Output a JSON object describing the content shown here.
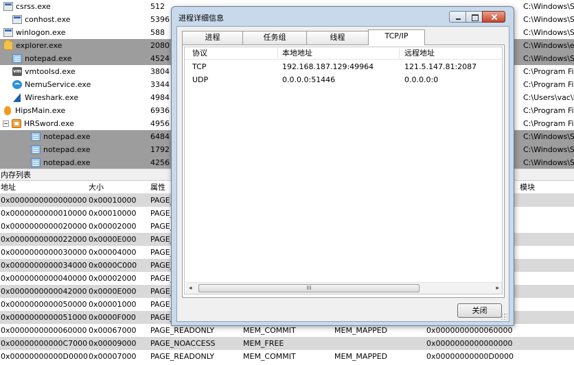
{
  "processes": [
    {
      "name": "csrss.exe",
      "pid": "512",
      "path": "C:\\Windows\\S",
      "icon": "window-icon",
      "indent": 1,
      "highlight": false
    },
    {
      "name": "conhost.exe",
      "pid": "5396",
      "path": "C:\\Windows\\S",
      "icon": "window-icon",
      "indent": 2,
      "highlight": false
    },
    {
      "name": "winlogon.exe",
      "pid": "588",
      "path": "C:\\Windows\\S",
      "icon": "window-icon",
      "indent": 1,
      "highlight": false
    },
    {
      "name": "explorer.exe",
      "pid": "2080",
      "path": "C:\\Windows\\e",
      "icon": "folder-icon",
      "indent": 1,
      "highlight": true
    },
    {
      "name": "notepad.exe",
      "pid": "4524",
      "path": "C:\\Windows\\S",
      "icon": "notepad-icon",
      "indent": 2,
      "highlight": true
    },
    {
      "name": "vmtoolsd.exe",
      "pid": "3804",
      "path": "C:\\Program Fil",
      "icon": "vmware-icon",
      "indent": 2,
      "highlight": false
    },
    {
      "name": "NemuService.exe",
      "pid": "3344",
      "path": "C:\\Program Fil",
      "icon": "nemu-icon",
      "indent": 2,
      "highlight": false
    },
    {
      "name": "Wireshark.exe",
      "pid": "4984",
      "path": "C:\\Users\\vac\\D",
      "icon": "wireshark-icon",
      "indent": 2,
      "highlight": false
    },
    {
      "name": "HipsMain.exe",
      "pid": "6936",
      "path": "C:\\Program Fil",
      "icon": "hips-icon",
      "indent": 1,
      "highlight": false
    },
    {
      "name": "HRSword.exe",
      "pid": "4956",
      "path": "C:\\Program Fil",
      "icon": "hrsword-icon",
      "indent": 2,
      "highlight": false
    },
    {
      "name": "notepad.exe",
      "pid": "6484",
      "path": "C:\\Windows\\S",
      "icon": "notepad-icon",
      "indent": 3,
      "highlight": true
    },
    {
      "name": "notepad.exe",
      "pid": "1792",
      "path": "C:\\Windows\\S",
      "icon": "notepad-icon",
      "indent": 3,
      "highlight": true
    },
    {
      "name": "notepad.exe",
      "pid": "4256",
      "path": "C:\\Windows\\S",
      "icon": "notepad-icon",
      "indent": 3,
      "highlight": true
    }
  ],
  "memory": {
    "title": "内存列表",
    "columns": {
      "address": "地址",
      "size": "大小",
      "attribute": "属性",
      "module": "模块"
    },
    "rows": [
      {
        "address": "0x0000000000000000",
        "size": "0x00010000",
        "attr": "PAGE_",
        "state": "",
        "type": "",
        "base": "",
        "hl": true
      },
      {
        "address": "0x0000000000010000",
        "size": "0x00010000",
        "attr": "PAGE_",
        "state": "",
        "type": "",
        "base": "",
        "hl": false
      },
      {
        "address": "0x0000000000020000",
        "size": "0x00002000",
        "attr": "PAGE_",
        "state": "",
        "type": "",
        "base": "",
        "hl": false
      },
      {
        "address": "0x0000000000022000",
        "size": "0x0000E000",
        "attr": "PAGE_",
        "state": "",
        "type": "",
        "base": "",
        "hl": true
      },
      {
        "address": "0x0000000000030000",
        "size": "0x00004000",
        "attr": "PAGE_",
        "state": "",
        "type": "",
        "base": "",
        "hl": false
      },
      {
        "address": "0x0000000000034000",
        "size": "0x0000C000",
        "attr": "PAGE_",
        "state": "",
        "type": "",
        "base": "",
        "hl": true
      },
      {
        "address": "0x0000000000040000",
        "size": "0x00002000",
        "attr": "PAGE_",
        "state": "",
        "type": "",
        "base": "",
        "hl": false
      },
      {
        "address": "0x0000000000042000",
        "size": "0x0000E000",
        "attr": "PAGE_",
        "state": "",
        "type": "",
        "base": "",
        "hl": true
      },
      {
        "address": "0x0000000000050000",
        "size": "0x00001000",
        "attr": "PAGE_",
        "state": "",
        "type": "",
        "base": "",
        "hl": false
      },
      {
        "address": "0x0000000000051000",
        "size": "0x0000F000",
        "attr": "PAGE_",
        "state": "",
        "type": "",
        "base": "",
        "hl": true
      },
      {
        "address": "0x0000000000060000",
        "size": "0x00067000",
        "attr": "PAGE_READONLY",
        "state": "MEM_COMMIT",
        "type": "MEM_MAPPED",
        "base": "0x0000000000060000",
        "hl": false
      },
      {
        "address": "0x00000000000C7000",
        "size": "0x00009000",
        "attr": "PAGE_NOACCESS",
        "state": "MEM_FREE",
        "type": "",
        "base": "0x0000000000000000",
        "hl": true
      },
      {
        "address": "0x00000000000D0000",
        "size": "0x00007000",
        "attr": "PAGE_READONLY",
        "state": "MEM_COMMIT",
        "type": "MEM_MAPPED",
        "base": "0x00000000000D0000",
        "hl": false
      }
    ]
  },
  "dialog": {
    "title": "进程详细信息",
    "tabs": [
      "进程",
      "任务组",
      "线程",
      "TCP/IP"
    ],
    "active_tab": "TCP/IP",
    "columns": {
      "protocol": "协议",
      "local": "本地地址",
      "remote": "远程地址"
    },
    "connections": [
      {
        "protocol": "TCP",
        "local": "192.168.187.129:49964",
        "remote": "121.5.147.81:2087"
      },
      {
        "protocol": "UDP",
        "local": "0.0.0.0:51446",
        "remote": "0.0.0.0:0"
      }
    ],
    "scroll_thumb": "III",
    "close_label": "关闭"
  },
  "colors": {
    "highlight_dark": "#9d9d9d",
    "highlight_light": "#d9d9d9",
    "dialog_frame": "#c8d9ec",
    "close_red": "#c7462d"
  }
}
